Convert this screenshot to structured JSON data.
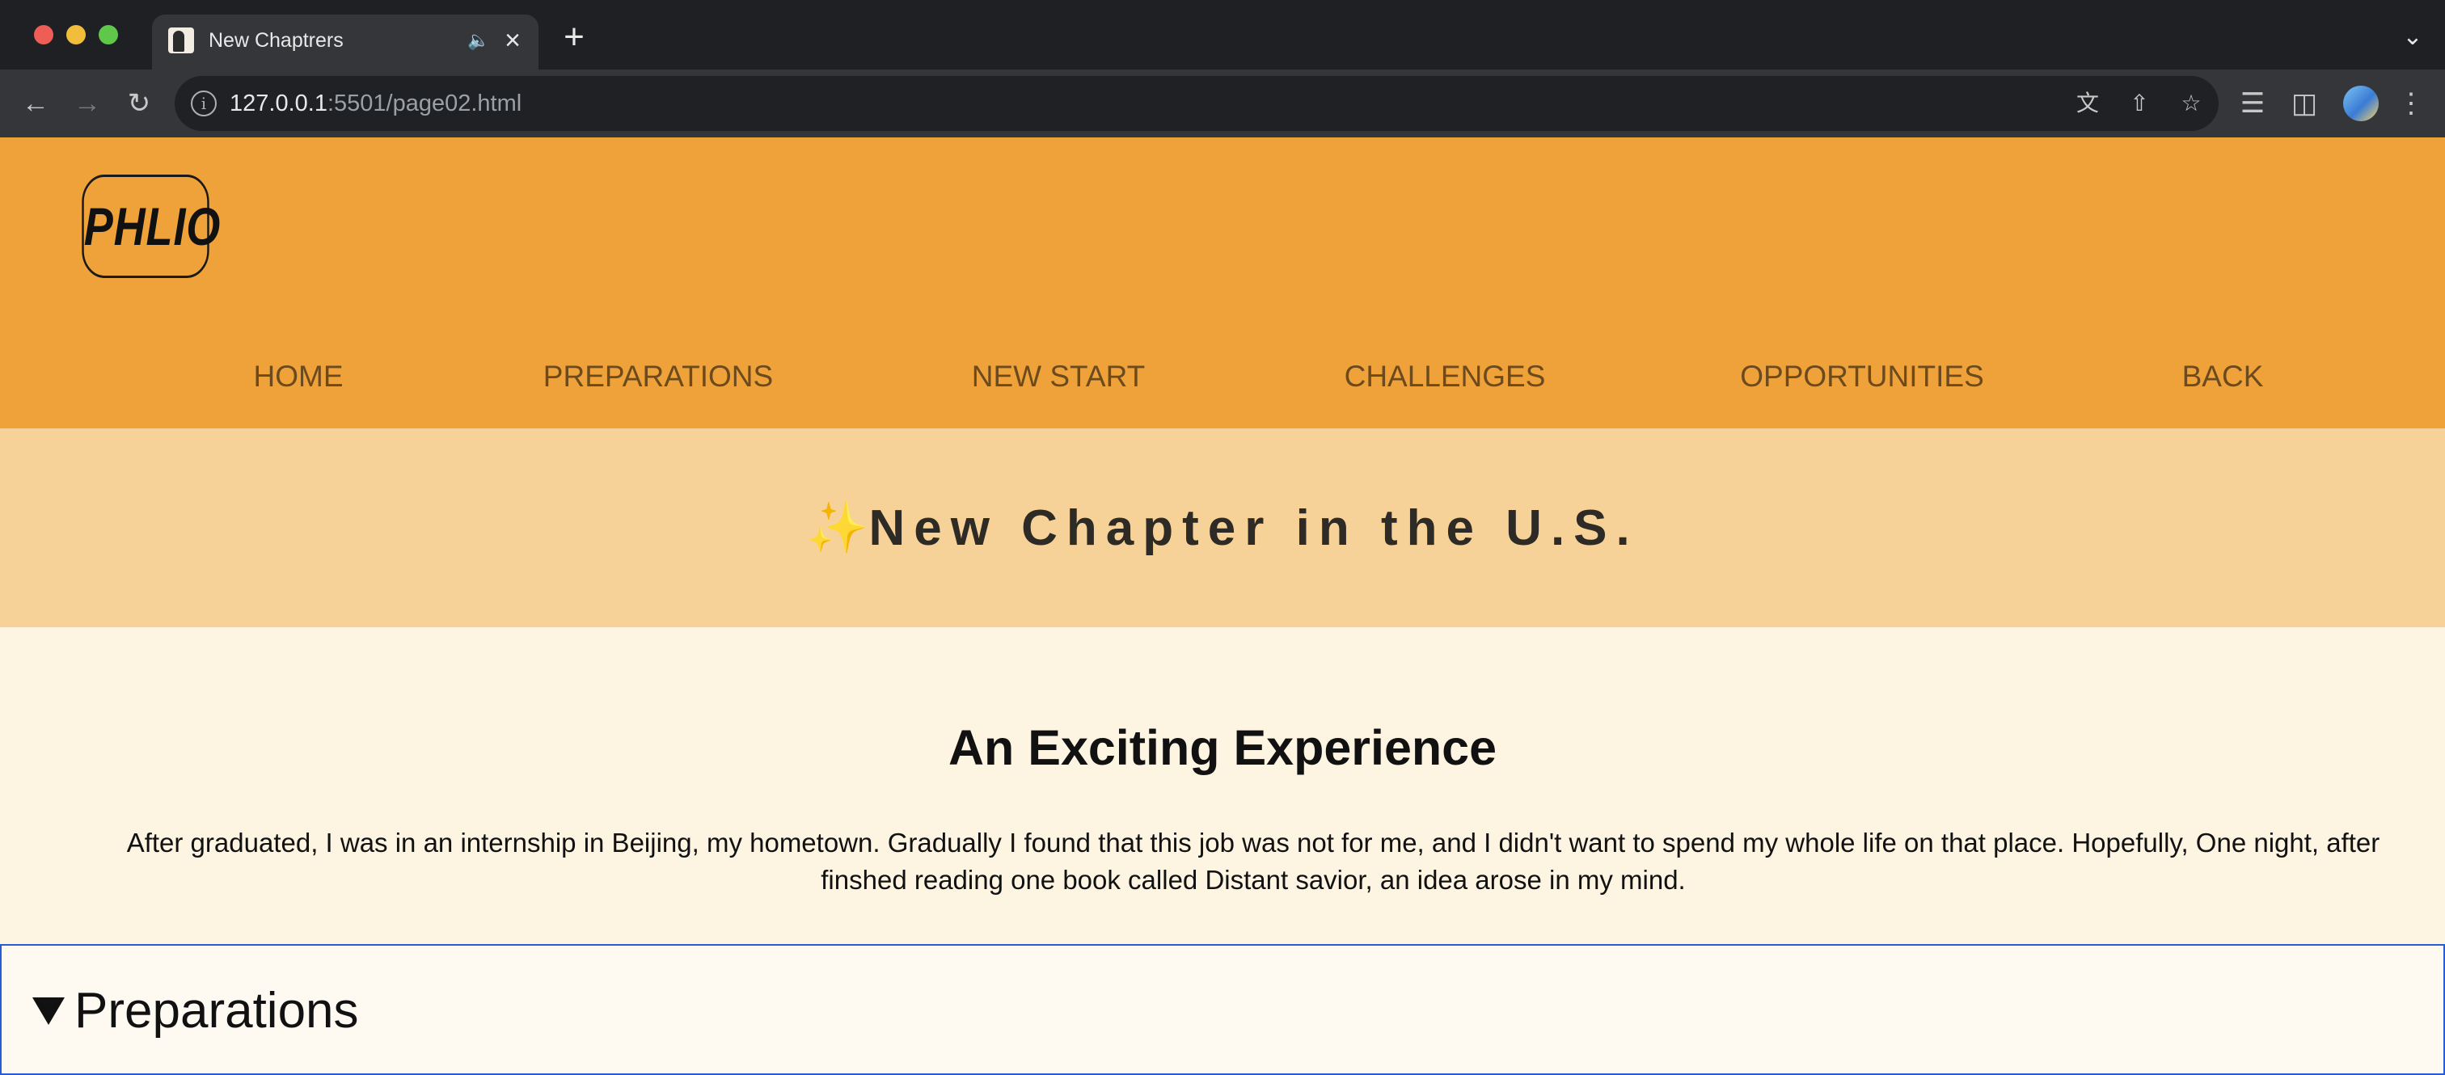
{
  "browser": {
    "tab": {
      "title": "New Chaptrers"
    },
    "url": {
      "host": "127.0.0.1",
      "rest": ":5501/page02.html"
    },
    "icons": {
      "back": "back-arrow-icon",
      "forward": "forward-arrow-icon",
      "reload": "reload-icon",
      "info": "site-info-icon",
      "translate": "translate-icon",
      "share": "share-icon",
      "bookmark": "star-icon",
      "media": "media-control-icon",
      "side_panel": "side-panel-icon",
      "menu": "kebab-menu-icon",
      "audio": "speaker-muted-icon",
      "new_tab": "plus-icon",
      "tab_search": "chevron-down-icon"
    }
  },
  "site": {
    "logo": "PHLIO",
    "nav": [
      "HOME",
      "PREPARATIONS",
      "NEW START",
      "CHALLENGES",
      "OPPORTUNITIES",
      "BACK"
    ],
    "banner": {
      "sparkle": "✨",
      "title": "New Chapter in the U.S."
    },
    "intro": {
      "heading": "An Exciting Experience",
      "text": "After graduated, I was in an internship in Beijing, my hometown. Gradually I found that this job was not for me, and I didn't want to spend my whole life on that place. Hopefully, One night, after finshed reading one book called Distant savior, an idea arose in my mind."
    },
    "details": {
      "summary": "Preparations"
    },
    "colors": {
      "header": "#f0a23a",
      "banner": "#f7d298",
      "body": "#fdf4e2",
      "nav_text": "#6b4a1e"
    }
  }
}
